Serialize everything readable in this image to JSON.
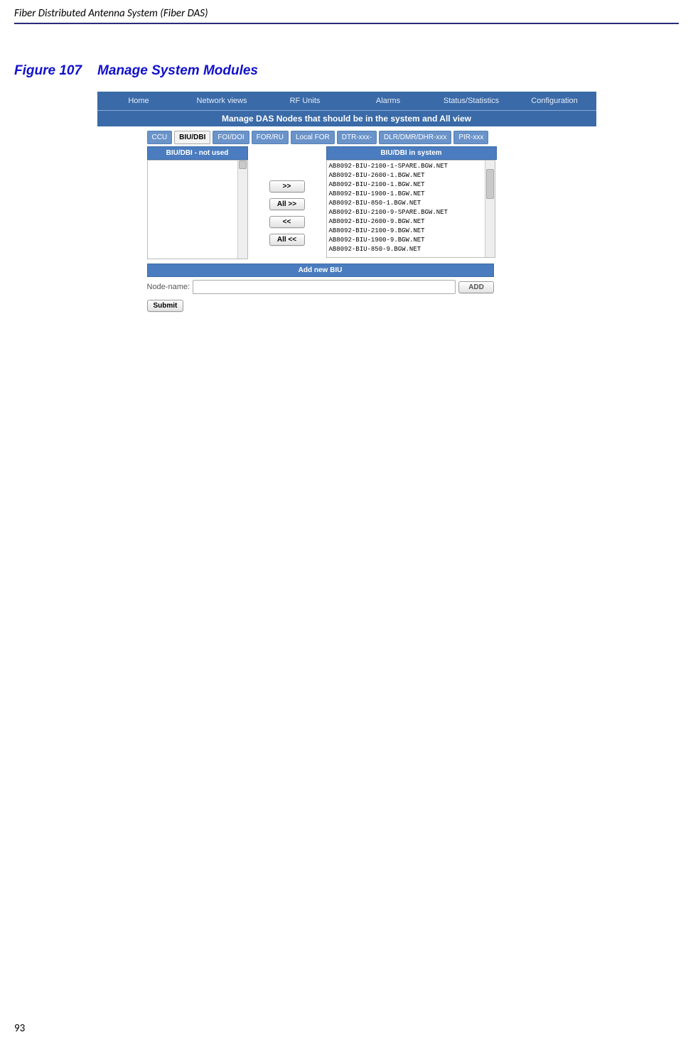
{
  "header": {
    "document_title": "Fiber Distributed Antenna System (Fiber DAS)"
  },
  "figure": {
    "label": "Figure 107",
    "title": "Manage System Modules"
  },
  "page_number": "93",
  "ui": {
    "nav": {
      "home": "Home",
      "network_views": "Network views",
      "rf_units": "RF Units",
      "alarms": "Alarms",
      "status": "Status/Statistics",
      "config": "Configuration"
    },
    "banner": "Manage DAS Nodes that should be in the system and All view",
    "tabs": {
      "ccu": "CCU",
      "biu": "BIU/DBI",
      "foi": "FOI/DOI",
      "forru": "FOR/RU",
      "localfor": "Local FOR",
      "dtr": "DTR-xxx-",
      "dlr": "DLR/DMR/DHR-xxx",
      "pir": "PIR-xxx"
    },
    "left_panel_title": "BIU/DBI - not used",
    "right_panel_title": "BIU/DBI in system",
    "right_items": [
      "AB8092-BIU-2100-1-SPARE.BGW.NET",
      "AB8092-BIU-2600-1.BGW.NET",
      "AB8092-BIU-2100-1.BGW.NET",
      "AB8092-BIU-1900-1.BGW.NET",
      "AB8092-BIU-850-1.BGW.NET",
      "AB8092-BIU-2100-9-SPARE.BGW.NET",
      "AB8092-BIU-2600-9.BGW.NET",
      "AB8092-BIU-2100-9.BGW.NET",
      "AB8092-BIU-1900-9.BGW.NET",
      "AB8092-BIU-850-9.BGW.NET"
    ],
    "buttons": {
      "move_right": ">>",
      "all_right": "All >>",
      "move_left": "<<",
      "all_left": "All <<",
      "add": "ADD",
      "submit": "Submit"
    },
    "add_section": {
      "header": "Add new BIU",
      "label": "Node-name:",
      "value": ""
    }
  }
}
